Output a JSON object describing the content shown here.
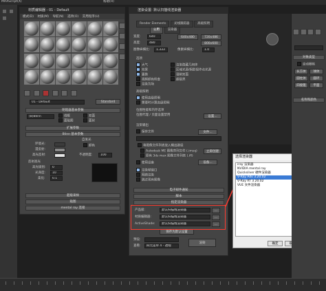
{
  "topbar": {
    "app": "MAXScript(X)",
    "menu_right": "帮助(H)"
  },
  "material_editor": {
    "title": "材质编辑器 - 01 - Default",
    "menu": [
      "模式(D)",
      "材质(M)",
      "导航(N)",
      "选项(O)",
      "实用程序(U)"
    ],
    "material_name": "01 - Default",
    "material_type": "Standard",
    "rollouts": {
      "shader_basic": "明暗器基本参数",
      "extended": "扩展参数",
      "blinn_basic": "Blinn 基本参数",
      "supersampling": "超级采样",
      "maps": "贴图",
      "mental_ray": "mental ray 连接"
    },
    "shader": {
      "value": "(B)Blinn",
      "options": [
        "线框",
        "双面",
        "面贴图",
        "面状"
      ]
    },
    "self_illum": "自发光",
    "color_label": "颜色",
    "ambient": "环境光:",
    "diffuse": "漫反射:",
    "specular": "高光反射:",
    "opacity": "不透明度:",
    "opacity_value": "100",
    "specular_highlights": "反射高光",
    "spec_level": "高光级别:",
    "spec_level_value": "0",
    "glossiness": "光泽度:",
    "glossiness_value": "10",
    "soften": "柔化:",
    "soften_value": "0.1"
  },
  "render_setup": {
    "title": "渲染设置: 默认扫描线渲染器",
    "tabs_row1": [
      "Render Elements",
      "光线跟踪器",
      "高级照明"
    ],
    "tabs_row2": [
      "公用",
      "渲染器"
    ],
    "width_label": "宽度:",
    "width_value": "640",
    "height_label": "高度:",
    "height_value": "480",
    "presets": [
      "640x480",
      "720x486",
      "800x600"
    ],
    "aperture_label": "图像纵横比:",
    "aperture_value": "1.333",
    "pixel_aspect_label": "像素纵横比:",
    "pixel_aspect_value": "1.0",
    "options_title": "选项",
    "options": [
      "大气",
      "效果",
      "置换",
      "视频颜色检查",
      "渲染为场"
    ],
    "options_right": [
      "渲染隐藏几何体",
      "区域光源/阴影视作点光源",
      "强制双面",
      "超级黑"
    ],
    "adv_light_title": "高级照明",
    "adv_light": [
      "使用高级照明",
      "需要时计算高级照明"
    ],
    "bitmap_title": "位图性能和内存选项",
    "bitmap_text": "位图代理 / 页面设置禁用",
    "bitmap_setup": "设置...",
    "output_title": "渲染输出",
    "save_file": "保存文件",
    "files_btn": "文件...",
    "put_image": "将图像文件列表放入输出路径",
    "create_now": "立即创建",
    "autodesk_seq": "Autodesk ME 图像序列文件 (.imsq)",
    "legacy_seq": "原有 3ds max 图像文件列表 (.ifl)",
    "use_device": "使用设备",
    "devices_btn": "设备...",
    "render_frame_window": "渲染帧窗口",
    "net_render": "网络渲染",
    "skip_existing": "跳过现有图像",
    "email": "电子邮件通知",
    "script": "脚本",
    "assign_renderer": "指定渲染器",
    "production_label": "产品级:",
    "production_value": "默认扫描线渲染器",
    "material_editor_label": "材质编辑器:",
    "material_editor_value": "默认扫描线渲染器",
    "activeshade_label": "ActiveShade:",
    "activeshade_value": "默认扫描线渲染器",
    "save_default": "保存为默认设置",
    "preset_label": "预设:",
    "view_label": "查看:",
    "view_value": "四元菜单 4 - 透视",
    "render_btn": "渲染",
    "dots": "..."
  },
  "choose_renderer": {
    "title": "选择渲染器",
    "items": [
      "iray 渲染器",
      "NVIDIA mental ray",
      "Quicksilver 硬件渲染器",
      "V-Ray Adv 3.20.02",
      "V-Ray RT 3.20.02",
      "VUE 文件渲染器"
    ],
    "selected_index": 3,
    "ok": "确定",
    "cancel": "取消"
  },
  "right_panel": {
    "object_type": "对象类型",
    "autogrid": "自动栅格",
    "name_color": "名称和颜色",
    "items": [
      "长方体",
      "球体",
      "圆柱体",
      "圆环",
      "四棱锥",
      "平面"
    ]
  },
  "colors": {
    "accent": "#ff3b2f",
    "selection": "#3a7bd5"
  }
}
